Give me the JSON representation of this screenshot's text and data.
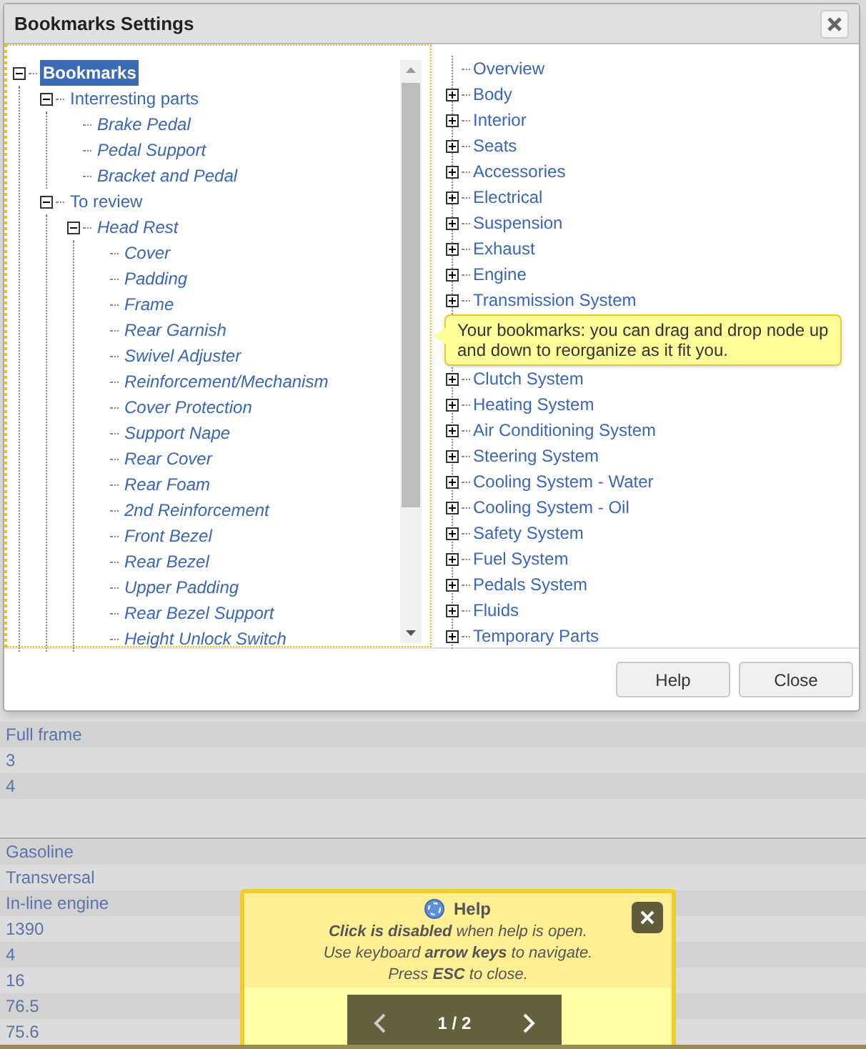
{
  "dialog": {
    "title": "Bookmarks Settings",
    "bookmarks_tree": [
      {
        "label": "Bookmarks",
        "italic": false,
        "selected": true,
        "expanded": true,
        "children": [
          {
            "label": "Interresting parts",
            "italic": false,
            "selected": false,
            "expanded": true,
            "children": [
              {
                "label": "Brake Pedal",
                "italic": true,
                "selected": false
              },
              {
                "label": "Pedal Support",
                "italic": true,
                "selected": false
              },
              {
                "label": "Bracket and Pedal",
                "italic": true,
                "selected": false
              }
            ]
          },
          {
            "label": "To review",
            "italic": false,
            "selected": false,
            "expanded": true,
            "children": [
              {
                "label": "Head Rest",
                "italic": true,
                "selected": false,
                "expanded": true,
                "children": [
                  {
                    "label": "Cover",
                    "italic": true,
                    "selected": false
                  },
                  {
                    "label": "Padding",
                    "italic": true,
                    "selected": false
                  },
                  {
                    "label": "Frame",
                    "italic": true,
                    "selected": false
                  },
                  {
                    "label": "Rear Garnish",
                    "italic": true,
                    "selected": false
                  },
                  {
                    "label": "Swivel Adjuster",
                    "italic": true,
                    "selected": false
                  },
                  {
                    "label": "Reinforcement/Mechanism",
                    "italic": true,
                    "selected": false
                  },
                  {
                    "label": "Cover Protection",
                    "italic": true,
                    "selected": false
                  },
                  {
                    "label": "Support Nape",
                    "italic": true,
                    "selected": false
                  },
                  {
                    "label": "Rear Cover",
                    "italic": true,
                    "selected": false
                  },
                  {
                    "label": "Rear Foam",
                    "italic": true,
                    "selected": false
                  },
                  {
                    "label": "2nd Reinforcement",
                    "italic": true,
                    "selected": false
                  },
                  {
                    "label": "Front Bezel",
                    "italic": true,
                    "selected": false
                  },
                  {
                    "label": "Rear Bezel",
                    "italic": true,
                    "selected": false
                  },
                  {
                    "label": "Upper Padding",
                    "italic": true,
                    "selected": false
                  },
                  {
                    "label": "Rear Bezel Support",
                    "italic": true,
                    "selected": false
                  },
                  {
                    "label": "Height Unlock Switch",
                    "italic": true,
                    "selected": false
                  }
                ]
              }
            ]
          }
        ]
      }
    ],
    "parts_tree": [
      {
        "label": "Overview",
        "kind": "leaf"
      },
      {
        "label": "Body",
        "kind": "node",
        "expanded": false
      },
      {
        "label": "Interior",
        "kind": "node",
        "expanded": false
      },
      {
        "label": "Seats",
        "kind": "node",
        "expanded": false
      },
      {
        "label": "Accessories",
        "kind": "node",
        "expanded": false
      },
      {
        "label": "Electrical",
        "kind": "node",
        "expanded": false
      },
      {
        "label": "Suspension",
        "kind": "node",
        "expanded": false
      },
      {
        "label": "Exhaust",
        "kind": "node",
        "expanded": false
      },
      {
        "label": "Engine",
        "kind": "node",
        "expanded": false
      },
      {
        "label": "Transmission System",
        "kind": "node",
        "expanded": false
      },
      {
        "kind": "tooltip",
        "text": "Your bookmarks: you can drag and drop node up and down to reorganize as it fit you."
      },
      {
        "label": "Clutch System",
        "kind": "node",
        "expanded": false
      },
      {
        "label": "Heating System",
        "kind": "node",
        "expanded": false
      },
      {
        "label": "Air Conditioning System",
        "kind": "node",
        "expanded": false
      },
      {
        "label": "Steering System",
        "kind": "node",
        "expanded": false
      },
      {
        "label": "Cooling System - Water",
        "kind": "node",
        "expanded": false
      },
      {
        "label": "Cooling System - Oil",
        "kind": "node",
        "expanded": false
      },
      {
        "label": "Safety System",
        "kind": "node",
        "expanded": false
      },
      {
        "label": "Fuel System",
        "kind": "node",
        "expanded": false
      },
      {
        "label": "Pedals System",
        "kind": "node",
        "expanded": false
      },
      {
        "label": "Fluids",
        "kind": "node",
        "expanded": false
      },
      {
        "label": "Temporary Parts",
        "kind": "node",
        "expanded": false
      }
    ],
    "buttons": [
      "Help",
      "Close"
    ]
  },
  "background_rows": [
    [
      "Full frame",
      "3",
      "4",
      ""
    ],
    [
      "Gasoline",
      "Transversal",
      "In-line engine",
      "1390",
      "4",
      "16",
      "76.5",
      "75.6"
    ]
  ],
  "help_panel": {
    "title": "Help",
    "lines": [
      "**Click is disabled** when help is open.",
      "Use keyboard **arrow keys** to navigate.",
      "Press **ESC** to close."
    ],
    "page": "1 / 2"
  }
}
